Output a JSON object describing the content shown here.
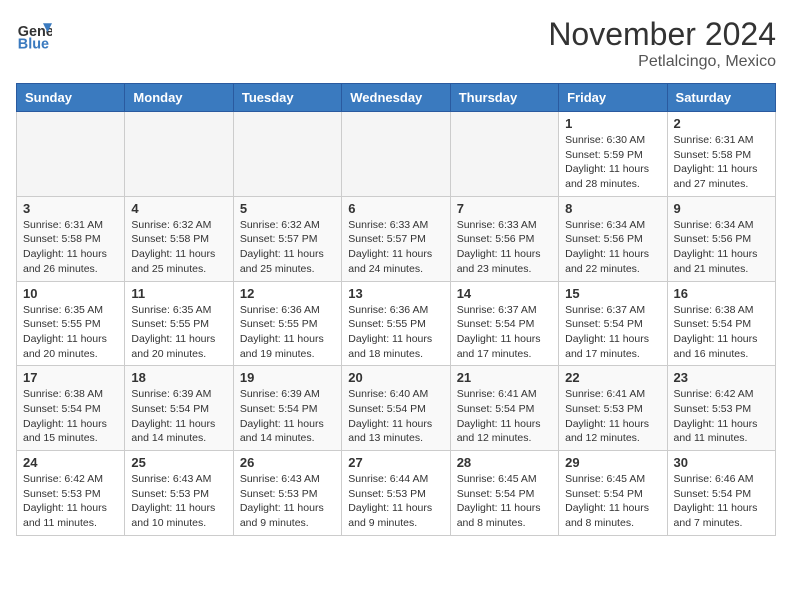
{
  "header": {
    "logo_general": "General",
    "logo_blue": "Blue",
    "month_title": "November 2024",
    "location": "Petlalcingo, Mexico"
  },
  "days_of_week": [
    "Sunday",
    "Monday",
    "Tuesday",
    "Wednesday",
    "Thursday",
    "Friday",
    "Saturday"
  ],
  "weeks": [
    [
      {
        "day": "",
        "empty": true
      },
      {
        "day": "",
        "empty": true
      },
      {
        "day": "",
        "empty": true
      },
      {
        "day": "",
        "empty": true
      },
      {
        "day": "",
        "empty": true
      },
      {
        "day": "1",
        "sunrise": "6:30 AM",
        "sunset": "5:59 PM",
        "daylight": "11 hours and 28 minutes."
      },
      {
        "day": "2",
        "sunrise": "6:31 AM",
        "sunset": "5:58 PM",
        "daylight": "11 hours and 27 minutes."
      }
    ],
    [
      {
        "day": "3",
        "sunrise": "6:31 AM",
        "sunset": "5:58 PM",
        "daylight": "11 hours and 26 minutes."
      },
      {
        "day": "4",
        "sunrise": "6:32 AM",
        "sunset": "5:58 PM",
        "daylight": "11 hours and 25 minutes."
      },
      {
        "day": "5",
        "sunrise": "6:32 AM",
        "sunset": "5:57 PM",
        "daylight": "11 hours and 25 minutes."
      },
      {
        "day": "6",
        "sunrise": "6:33 AM",
        "sunset": "5:57 PM",
        "daylight": "11 hours and 24 minutes."
      },
      {
        "day": "7",
        "sunrise": "6:33 AM",
        "sunset": "5:56 PM",
        "daylight": "11 hours and 23 minutes."
      },
      {
        "day": "8",
        "sunrise": "6:34 AM",
        "sunset": "5:56 PM",
        "daylight": "11 hours and 22 minutes."
      },
      {
        "day": "9",
        "sunrise": "6:34 AM",
        "sunset": "5:56 PM",
        "daylight": "11 hours and 21 minutes."
      }
    ],
    [
      {
        "day": "10",
        "sunrise": "6:35 AM",
        "sunset": "5:55 PM",
        "daylight": "11 hours and 20 minutes."
      },
      {
        "day": "11",
        "sunrise": "6:35 AM",
        "sunset": "5:55 PM",
        "daylight": "11 hours and 20 minutes."
      },
      {
        "day": "12",
        "sunrise": "6:36 AM",
        "sunset": "5:55 PM",
        "daylight": "11 hours and 19 minutes."
      },
      {
        "day": "13",
        "sunrise": "6:36 AM",
        "sunset": "5:55 PM",
        "daylight": "11 hours and 18 minutes."
      },
      {
        "day": "14",
        "sunrise": "6:37 AM",
        "sunset": "5:54 PM",
        "daylight": "11 hours and 17 minutes."
      },
      {
        "day": "15",
        "sunrise": "6:37 AM",
        "sunset": "5:54 PM",
        "daylight": "11 hours and 17 minutes."
      },
      {
        "day": "16",
        "sunrise": "6:38 AM",
        "sunset": "5:54 PM",
        "daylight": "11 hours and 16 minutes."
      }
    ],
    [
      {
        "day": "17",
        "sunrise": "6:38 AM",
        "sunset": "5:54 PM",
        "daylight": "11 hours and 15 minutes."
      },
      {
        "day": "18",
        "sunrise": "6:39 AM",
        "sunset": "5:54 PM",
        "daylight": "11 hours and 14 minutes."
      },
      {
        "day": "19",
        "sunrise": "6:39 AM",
        "sunset": "5:54 PM",
        "daylight": "11 hours and 14 minutes."
      },
      {
        "day": "20",
        "sunrise": "6:40 AM",
        "sunset": "5:54 PM",
        "daylight": "11 hours and 13 minutes."
      },
      {
        "day": "21",
        "sunrise": "6:41 AM",
        "sunset": "5:54 PM",
        "daylight": "11 hours and 12 minutes."
      },
      {
        "day": "22",
        "sunrise": "6:41 AM",
        "sunset": "5:53 PM",
        "daylight": "11 hours and 12 minutes."
      },
      {
        "day": "23",
        "sunrise": "6:42 AM",
        "sunset": "5:53 PM",
        "daylight": "11 hours and 11 minutes."
      }
    ],
    [
      {
        "day": "24",
        "sunrise": "6:42 AM",
        "sunset": "5:53 PM",
        "daylight": "11 hours and 11 minutes."
      },
      {
        "day": "25",
        "sunrise": "6:43 AM",
        "sunset": "5:53 PM",
        "daylight": "11 hours and 10 minutes."
      },
      {
        "day": "26",
        "sunrise": "6:43 AM",
        "sunset": "5:53 PM",
        "daylight": "11 hours and 9 minutes."
      },
      {
        "day": "27",
        "sunrise": "6:44 AM",
        "sunset": "5:53 PM",
        "daylight": "11 hours and 9 minutes."
      },
      {
        "day": "28",
        "sunrise": "6:45 AM",
        "sunset": "5:54 PM",
        "daylight": "11 hours and 8 minutes."
      },
      {
        "day": "29",
        "sunrise": "6:45 AM",
        "sunset": "5:54 PM",
        "daylight": "11 hours and 8 minutes."
      },
      {
        "day": "30",
        "sunrise": "6:46 AM",
        "sunset": "5:54 PM",
        "daylight": "11 hours and 7 minutes."
      }
    ]
  ]
}
